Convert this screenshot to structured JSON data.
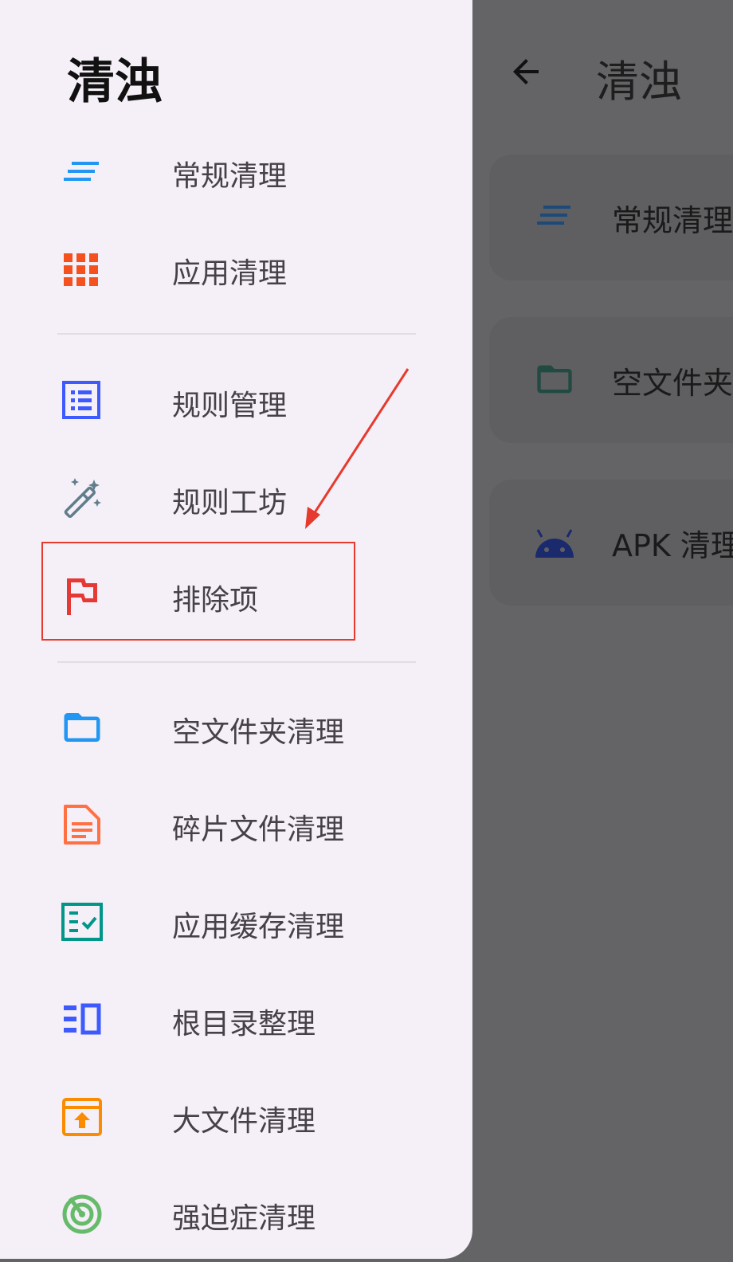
{
  "background": {
    "title": "清浊",
    "cards": [
      {
        "label": "常规清理",
        "icon": "short-text-icon"
      },
      {
        "label": "空文件夹",
        "icon": "folder-icon"
      },
      {
        "label": "APK 清理",
        "icon": "android-icon"
      }
    ]
  },
  "drawer": {
    "title": "清浊",
    "group1": [
      {
        "label": "常规清理",
        "icon": "short-text-icon",
        "color": "#2196f3"
      },
      {
        "label": "应用清理",
        "icon": "apps-grid-icon",
        "color": "#f4511e"
      }
    ],
    "group2": [
      {
        "label": "规则管理",
        "icon": "list-alt-icon",
        "color": "#3d5afe"
      },
      {
        "label": "规则工坊",
        "icon": "magic-wand-icon",
        "color": "#607d8b"
      },
      {
        "label": "排除项",
        "icon": "flag-icon",
        "color": "#e53935"
      }
    ],
    "group3": [
      {
        "label": "空文件夹清理",
        "icon": "folder-icon",
        "color": "#2196f3"
      },
      {
        "label": "碎片文件清理",
        "icon": "document-icon",
        "color": "#ff7043"
      },
      {
        "label": "应用缓存清理",
        "icon": "checklist-icon",
        "color": "#009688"
      },
      {
        "label": "根目录整理",
        "icon": "view-sidebar-icon",
        "color": "#3d5afe"
      },
      {
        "label": "大文件清理",
        "icon": "archive-icon",
        "color": "#fb8c00"
      },
      {
        "label": "强迫症清理",
        "icon": "radar-icon",
        "color": "#66bb6a"
      }
    ]
  },
  "annotation": {
    "color": "#e53a2d"
  }
}
